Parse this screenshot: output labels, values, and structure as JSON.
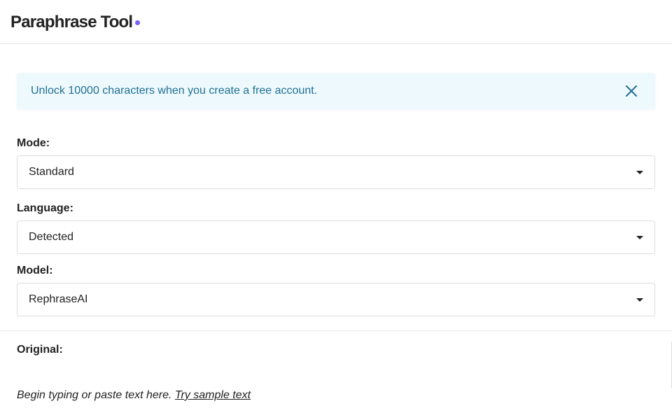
{
  "header": {
    "title": "Paraphrase Tool",
    "accent_color": "#7c5cff"
  },
  "banner": {
    "text": "Unlock 10000 characters when you create a free account.",
    "close_icon": "close-icon",
    "background_color": "#eef9fd",
    "text_color": "#1f6f93"
  },
  "mode": {
    "label": "Mode:",
    "value": "Standard"
  },
  "language": {
    "label": "Language:",
    "value": "Detected"
  },
  "model": {
    "label": "Model:",
    "value": "RephraseAI"
  },
  "original": {
    "label": "Original:",
    "placeholder": "Begin typing or paste text here.",
    "sample_link": "Try sample text"
  }
}
